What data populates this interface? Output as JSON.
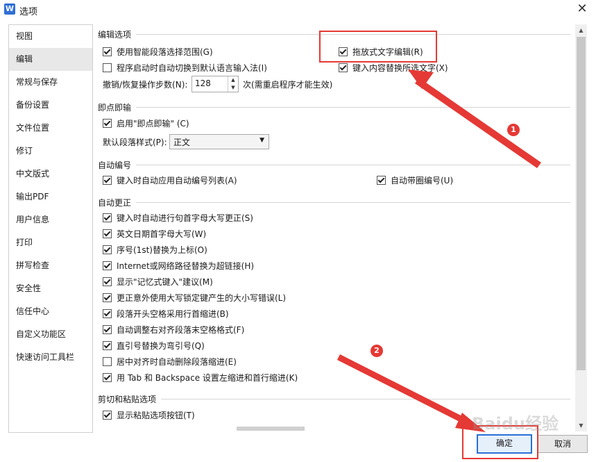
{
  "window": {
    "title": "选项",
    "app_icon": "W",
    "close_glyph": "✕"
  },
  "sidebar": {
    "items": [
      {
        "label": "视图"
      },
      {
        "label": "编辑"
      },
      {
        "label": "常规与保存"
      },
      {
        "label": "备份设置"
      },
      {
        "label": "文件位置"
      },
      {
        "label": "修订"
      },
      {
        "label": "中文版式"
      },
      {
        "label": "输出PDF"
      },
      {
        "label": "用户信息"
      },
      {
        "label": "打印"
      },
      {
        "label": "拼写检查"
      },
      {
        "label": "安全性"
      },
      {
        "label": "信任中心"
      },
      {
        "label": "自定义功能区"
      },
      {
        "label": "快速访问工具栏"
      }
    ],
    "active": "编辑"
  },
  "edit_options": {
    "title": "编辑选项",
    "smart_para": {
      "label": "使用智能段落选择范围(G)",
      "checked": true
    },
    "drag_drop": {
      "label": "拖放式文字编辑(R)",
      "checked": true
    },
    "auto_ime": {
      "label": "程序启动时自动切换到默认语言输入法(I)",
      "checked": false
    },
    "replace_sel": {
      "label": "键入内容替换所选文字(X)",
      "checked": true
    },
    "undo_label": "撤销/恢复操作步数(N):",
    "undo_value": "128",
    "undo_suffix": "次(需重启程序才能生效)"
  },
  "click_type": {
    "title": "即点即输",
    "enable": {
      "label": "启用\"即点即输\" (C)",
      "checked": true
    },
    "para_style_label": "默认段落样式(P):",
    "para_style_value": "正文"
  },
  "auto_number": {
    "title": "自动编号",
    "auto_list": {
      "label": "键入时自动应用自动编号列表(A)",
      "checked": true
    },
    "circle_num": {
      "label": "自动带圈编号(U)",
      "checked": true
    }
  },
  "auto_correct": {
    "title": "自动更正",
    "items": [
      {
        "label": "键入时自动进行句首字母大写更正(S)",
        "checked": true
      },
      {
        "label": "英文日期首字母大写(W)",
        "checked": true
      },
      {
        "label": "序号(1st)替换为上标(O)",
        "checked": true
      },
      {
        "label": "Internet或网络路径替换为超链接(H)",
        "checked": true
      },
      {
        "label": "显示\"记忆式键入\"建议(M)",
        "checked": true
      },
      {
        "label": "更正意外使用大写锁定键产生的大小写错误(L)",
        "checked": true
      },
      {
        "label": "段落开头空格采用行首缩进(B)",
        "checked": true
      },
      {
        "label": "自动调整右对齐段落末空格格式(F)",
        "checked": true
      },
      {
        "label": "直引号替换为弯引号(Q)",
        "checked": true
      },
      {
        "label": "居中对齐时自动删除段落缩进(E)",
        "checked": false
      },
      {
        "label": "用 Tab 和 Backspace 设置左缩进和首行缩进(K)",
        "checked": true
      }
    ]
  },
  "cut_paste": {
    "title": "剪切和粘贴选项",
    "show_btn": {
      "label": "显示粘贴选项按钮(T)",
      "checked": true
    }
  },
  "footer": {
    "ok_label": "确定",
    "cancel_label": "取消"
  },
  "annotations": {
    "num1": "1",
    "num2": "2",
    "color": "#e53935"
  },
  "watermark": "Baidu经验"
}
